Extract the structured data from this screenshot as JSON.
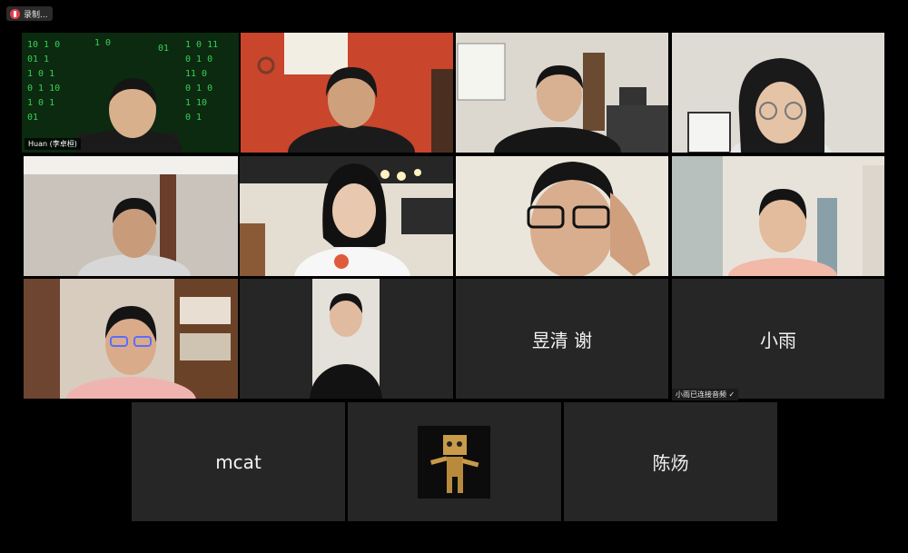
{
  "toolbar": {
    "record_label": "录制...",
    "record_icon": "cloud-record-icon",
    "record_color": "#e5404a"
  },
  "gallery": {
    "tiles": [
      {
        "id": "t1",
        "name_tag": "Huan (李卓桓)",
        "active": true
      },
      {
        "id": "t2"
      },
      {
        "id": "t3"
      },
      {
        "id": "t4"
      },
      {
        "id": "t5"
      },
      {
        "id": "t6"
      },
      {
        "id": "t7"
      },
      {
        "id": "t8"
      },
      {
        "id": "t9"
      },
      {
        "id": "t10"
      },
      {
        "id": "t11",
        "display_name": "昱清 谢"
      },
      {
        "id": "t12",
        "display_name": "小雨",
        "toast": "小雨已连接音频 ✓"
      },
      {
        "id": "t13",
        "display_name": "mcat"
      },
      {
        "id": "t14"
      },
      {
        "id": "t15",
        "display_name": "陈炀"
      }
    ],
    "active_speaker_color": "#c6f24a"
  }
}
